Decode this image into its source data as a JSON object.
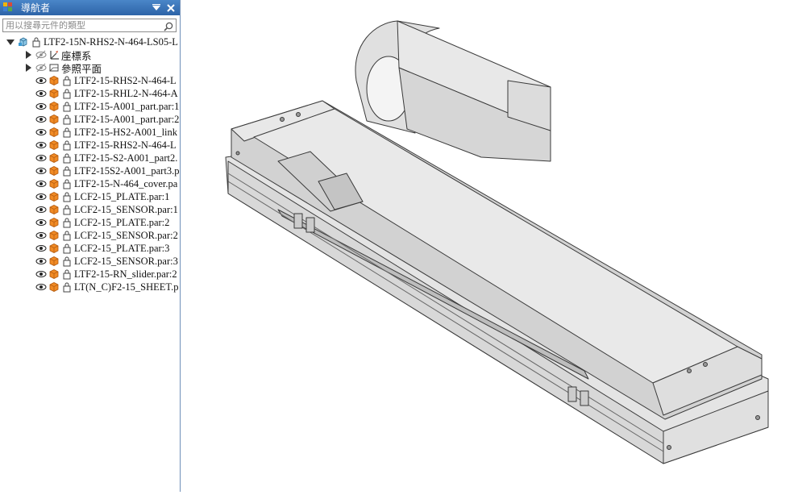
{
  "navigator": {
    "title": "導航者",
    "search_placeholder": "用以搜尋元件的類型",
    "root": {
      "label": "LTF2-15N-RHS2-N-464-LS05-L"
    },
    "nodes": [
      {
        "label": "座標系",
        "icon": "coordinate-system-icon"
      },
      {
        "label": "參照平面",
        "icon": "reference-plane-icon"
      }
    ],
    "parts": [
      {
        "label": "LTF2-15-RHS2-N-464-L",
        "icon": "part-icon"
      },
      {
        "label": "LTF2-15-RHL2-N-464-A",
        "icon": "part-icon"
      },
      {
        "label": "LTF2-15-A001_part.par:1",
        "icon": "part-icon"
      },
      {
        "label": "LTF2-15-A001_part.par:2",
        "icon": "part-icon"
      },
      {
        "label": "LTF2-15-HS2-A001_link",
        "icon": "part-icon"
      },
      {
        "label": "LTF2-15-RHS2-N-464-L",
        "icon": "part-icon"
      },
      {
        "label": "LTF2-15-S2-A001_part2.",
        "icon": "part-icon"
      },
      {
        "label": "LTF2-15S2-A001_part3.p",
        "icon": "part-icon"
      },
      {
        "label": "LTF2-15-N-464_cover.pa",
        "icon": "part-icon"
      },
      {
        "label": "LCF2-15_PLATE.par:1",
        "icon": "part-icon"
      },
      {
        "label": "LCF2-15_SENSOR.par:1",
        "icon": "part-icon"
      },
      {
        "label": "LCF2-15_PLATE.par:2",
        "icon": "part-icon"
      },
      {
        "label": "LCF2-15_SENSOR.par:2",
        "icon": "part-icon"
      },
      {
        "label": "LCF2-15_PLATE.par:3",
        "icon": "part-icon"
      },
      {
        "label": "LCF2-15_SENSOR.par:3",
        "icon": "part-icon"
      },
      {
        "label": "LTF2-15-RN_slider.par:2",
        "icon": "part-icon"
      },
      {
        "label": "LT(N_C)F2-15_SHEET.p",
        "icon": "part-icon"
      }
    ]
  },
  "colors": {
    "title_bar": "#2d64a8",
    "part_orange": "#f08a24",
    "model_face": "#e6e6e6",
    "model_edge": "#3a3a3a"
  }
}
